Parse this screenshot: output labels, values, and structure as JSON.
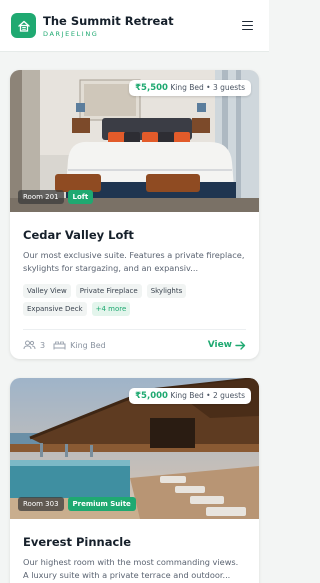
{
  "header": {
    "title": "The Summit Retreat",
    "subtitle": "DARJEELING"
  },
  "colors": {
    "accent": "#1fa971",
    "text": "#16202b",
    "muted": "#8a93a0"
  },
  "rooms": [
    {
      "price": "₹5,500",
      "bed_and_guests": "King Bed • 3 guests",
      "room_number": "Room 201",
      "type": "Loft",
      "name": "Cedar Valley Loft",
      "description": "Our most exclusive suite. Features a private fireplace, skylights for stargazing, and an expansiv...",
      "amenities": [
        "Valley View",
        "Private Fireplace",
        "Skylights",
        "Expansive Deck"
      ],
      "more": "+4 more",
      "guests": "3",
      "bed": "King Bed",
      "cta": "View"
    },
    {
      "price": "₹5,000",
      "bed_and_guests": "King Bed • 2 guests",
      "room_number": "Room 303",
      "type": "Premium Suite",
      "name": "Everest Pinnacle",
      "description": "Our highest room with the most commanding views. A luxury suite with a private terrace and outdoor..."
    }
  ]
}
